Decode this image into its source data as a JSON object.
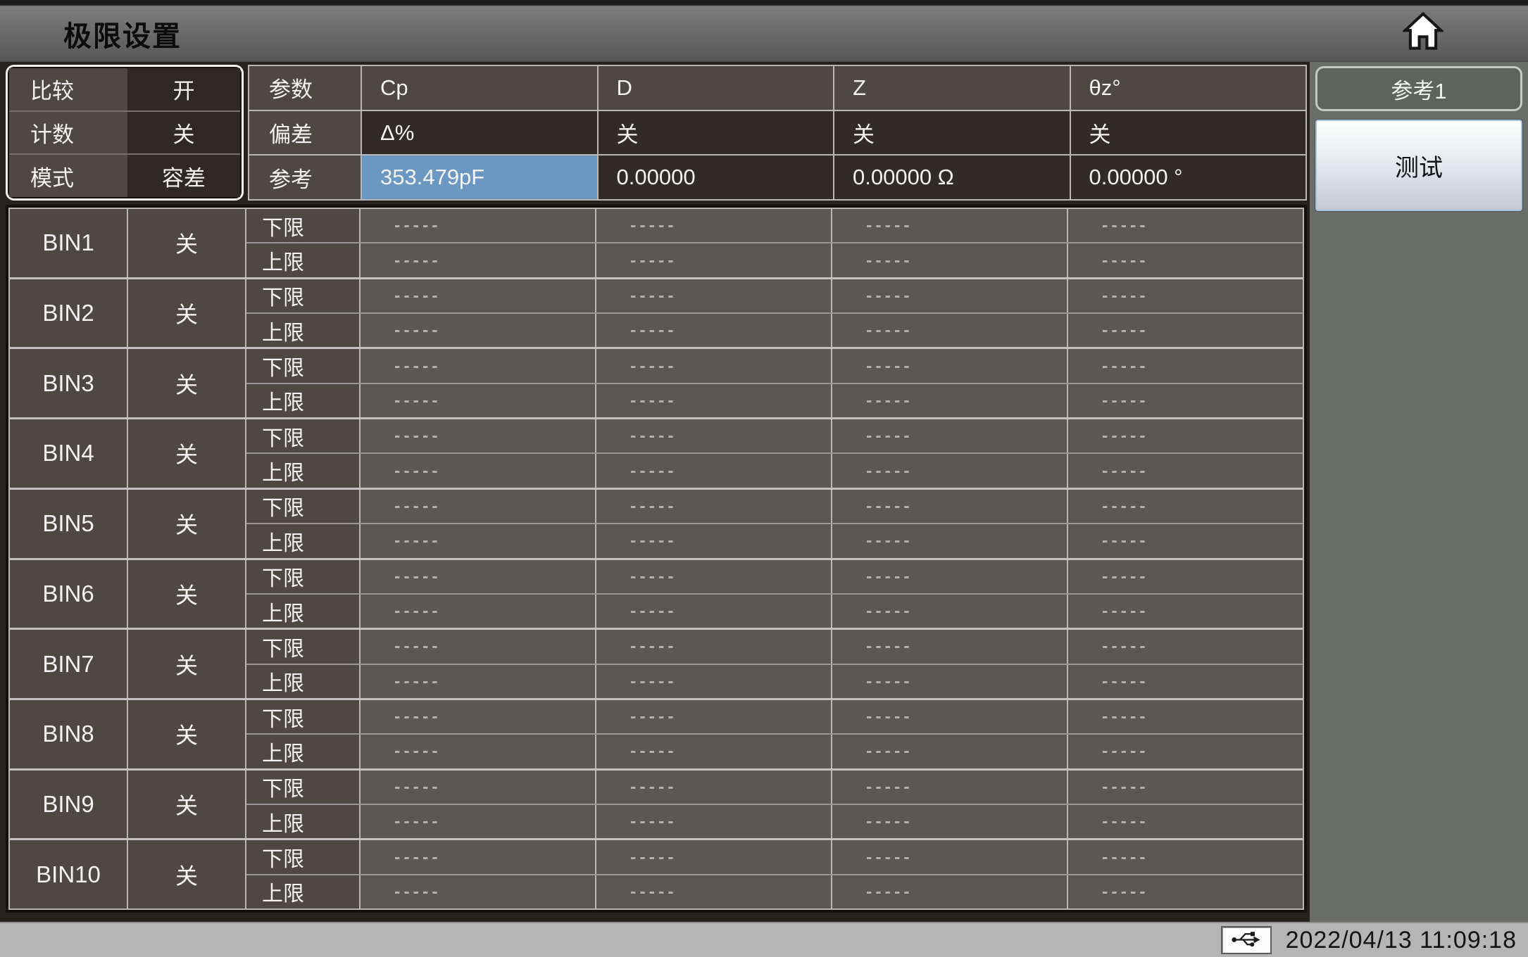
{
  "header": {
    "title": "极限设置"
  },
  "comparator_panel": {
    "rows": [
      {
        "label": "比较",
        "value": "开"
      },
      {
        "label": "计数",
        "value": "关"
      },
      {
        "label": "模式",
        "value": "容差"
      }
    ]
  },
  "param_table": {
    "param_row": {
      "label": "参数",
      "values": [
        "Cp",
        "D",
        "Z",
        "θz°"
      ]
    },
    "deviation_row": {
      "label": "偏差",
      "values": [
        "Δ%",
        "关",
        "关",
        "关"
      ]
    },
    "reference_row": {
      "label": "参考",
      "values": [
        "353.479pF",
        "0.00000",
        "0.00000 Ω",
        "0.00000 °"
      ],
      "highlighted_column": 0
    }
  },
  "side_panel": {
    "reference_button": "参考1",
    "test_button": "测试"
  },
  "bin_table": {
    "lower_label": "下限",
    "upper_label": "上限",
    "empty_value": "-----",
    "bins": [
      {
        "name": "BIN1",
        "status": "关",
        "lower": [
          "-----",
          "-----",
          "-----",
          "-----"
        ],
        "upper": [
          "-----",
          "-----",
          "-----",
          "-----"
        ]
      },
      {
        "name": "BIN2",
        "status": "关",
        "lower": [
          "-----",
          "-----",
          "-----",
          "-----"
        ],
        "upper": [
          "-----",
          "-----",
          "-----",
          "-----"
        ]
      },
      {
        "name": "BIN3",
        "status": "关",
        "lower": [
          "-----",
          "-----",
          "-----",
          "-----"
        ],
        "upper": [
          "-----",
          "-----",
          "-----",
          "-----"
        ]
      },
      {
        "name": "BIN4",
        "status": "关",
        "lower": [
          "-----",
          "-----",
          "-----",
          "-----"
        ],
        "upper": [
          "-----",
          "-----",
          "-----",
          "-----"
        ]
      },
      {
        "name": "BIN5",
        "status": "关",
        "lower": [
          "-----",
          "-----",
          "-----",
          "-----"
        ],
        "upper": [
          "-----",
          "-----",
          "-----",
          "-----"
        ]
      },
      {
        "name": "BIN6",
        "status": "关",
        "lower": [
          "-----",
          "-----",
          "-----",
          "-----"
        ],
        "upper": [
          "-----",
          "-----",
          "-----",
          "-----"
        ]
      },
      {
        "name": "BIN7",
        "status": "关",
        "lower": [
          "-----",
          "-----",
          "-----",
          "-----"
        ],
        "upper": [
          "-----",
          "-----",
          "-----",
          "-----"
        ]
      },
      {
        "name": "BIN8",
        "status": "关",
        "lower": [
          "-----",
          "-----",
          "-----",
          "-----"
        ],
        "upper": [
          "-----",
          "-----",
          "-----",
          "-----"
        ]
      },
      {
        "name": "BIN9",
        "status": "关",
        "lower": [
          "-----",
          "-----",
          "-----",
          "-----"
        ],
        "upper": [
          "-----",
          "-----",
          "-----",
          "-----"
        ]
      },
      {
        "name": "BIN10",
        "status": "关",
        "lower": [
          "-----",
          "-----",
          "-----",
          "-----"
        ],
        "upper": [
          "-----",
          "-----",
          "-----",
          "-----"
        ]
      }
    ]
  },
  "status_bar": {
    "datetime": "2022/04/13 11:09:18"
  },
  "colors": {
    "highlight_blue": "#6b98c3",
    "cell_label_bg": "#4e4843",
    "cell_dark_bg": "#2e2925",
    "cell_value_bg": "#5a5754",
    "right_panel_bg": "#6b6e68",
    "status_bar_bg": "#b5b5b5"
  }
}
